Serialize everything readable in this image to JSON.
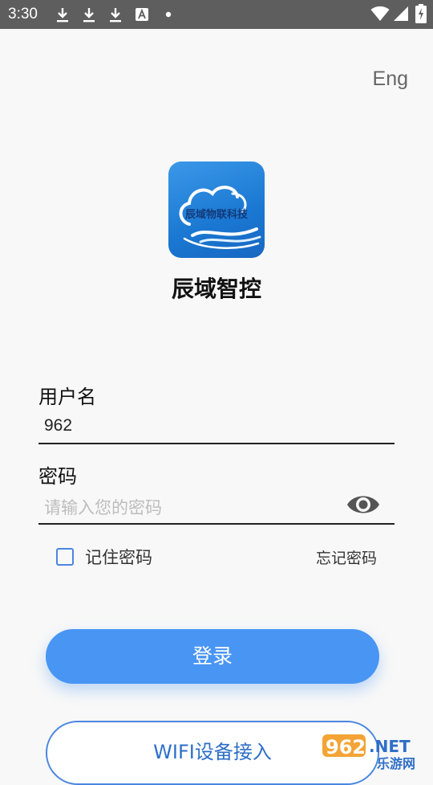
{
  "status_bar": {
    "time": "3:30",
    "icons": [
      "download-icon",
      "download-icon",
      "download-icon",
      "font-icon",
      "dot-icon",
      "wifi-icon",
      "signal-icon",
      "battery-charging-icon"
    ]
  },
  "header": {
    "language_toggle": "Eng"
  },
  "logo": {
    "text": "辰域物联科技"
  },
  "app_name": "辰域智控",
  "form": {
    "username_label": "用户名",
    "username_value": "962",
    "password_label": "密码",
    "password_placeholder": "请输入您的密码",
    "remember_label": "记住密码",
    "remember_checked": false,
    "forgot_label": "忘记密码"
  },
  "buttons": {
    "login": "登录",
    "wifi": "WIFI设备接入"
  },
  "watermark": {
    "top": "962.NET",
    "bottom": "乐游网"
  },
  "colors": {
    "primary": "#4895f4",
    "outline": "#4a86e0",
    "status_bar": "#5e5e5e"
  }
}
